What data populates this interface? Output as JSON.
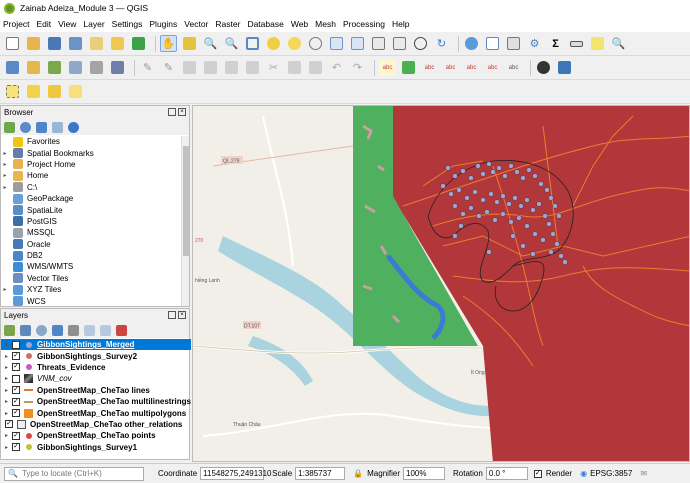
{
  "window": {
    "title": "Zainab Adeiza_Module 3 — QGIS"
  },
  "menu": [
    "Project",
    "Edit",
    "View",
    "Layer",
    "Settings",
    "Plugins",
    "Vector",
    "Raster",
    "Database",
    "Web",
    "Mesh",
    "Processing",
    "Help"
  ],
  "browser": {
    "title": "Browser",
    "items": [
      {
        "label": "Favorites",
        "icon": "star-icon",
        "color": "#f2c511",
        "expand": false
      },
      {
        "label": "Spatial Bookmarks",
        "icon": "bookmark-icon",
        "color": "#6a7ba8",
        "expand": true
      },
      {
        "label": "Project Home",
        "icon": "folder-icon",
        "color": "#e8b44f",
        "expand": true
      },
      {
        "label": "Home",
        "icon": "folder-icon",
        "color": "#e8b44f",
        "expand": true
      },
      {
        "label": "C:\\",
        "icon": "drive-icon",
        "color": "#9c9c9c",
        "expand": true
      },
      {
        "label": "GeoPackage",
        "icon": "geopackage-icon",
        "color": "#6a9fd6",
        "expand": false
      },
      {
        "label": "SpatiaLite",
        "icon": "spatialite-icon",
        "color": "#5a8fc5",
        "expand": false
      },
      {
        "label": "PostGIS",
        "icon": "postgis-icon",
        "color": "#3f6fa8",
        "expand": false
      },
      {
        "label": "MSSQL",
        "icon": "mssql-icon",
        "color": "#9aa4b0",
        "expand": false
      },
      {
        "label": "Oracle",
        "icon": "oracle-icon",
        "color": "#4779b6",
        "expand": false
      },
      {
        "label": "DB2",
        "icon": "db2-icon",
        "color": "#4c86c6",
        "expand": false
      },
      {
        "label": "WMS/WMTS",
        "icon": "globe-icon",
        "color": "#3d8fd4",
        "expand": false
      },
      {
        "label": "Vector Tiles",
        "icon": "vector-tiles-icon",
        "color": "#6b8fc2",
        "expand": false
      },
      {
        "label": "XYZ Tiles",
        "icon": "xyz-tiles-icon",
        "color": "#5b9ad8",
        "expand": true
      },
      {
        "label": "WCS",
        "icon": "wcs-icon",
        "color": "#5b9ad8",
        "expand": false
      }
    ]
  },
  "layers": {
    "title": "Layers",
    "items": [
      {
        "label": "GibbonSightings_Merged",
        "sym": "point",
        "color": "#9fa3d6",
        "checked": true,
        "selected": true,
        "italic": false,
        "group": false
      },
      {
        "label": "GibbonSightings_Survey2",
        "sym": "point",
        "color": "#d56f5f",
        "checked": true,
        "selected": false,
        "italic": false,
        "group": false
      },
      {
        "label": "Threats_Evidence",
        "sym": "point",
        "color": "#c45cc4",
        "checked": true,
        "selected": false,
        "italic": false,
        "group": false
      },
      {
        "label": "VNM_cov",
        "sym": "raster",
        "color": "#6a7ba8",
        "checked": false,
        "selected": false,
        "italic": true,
        "group": false
      },
      {
        "label": "OpenStreetMap_CheTao lines",
        "sym": "line",
        "color": "#e07b34",
        "checked": true,
        "selected": false,
        "italic": false,
        "group": false
      },
      {
        "label": "OpenStreetMap_CheTao multilinestrings",
        "sym": "line",
        "color": "#bf9a5a",
        "checked": true,
        "selected": false,
        "italic": false,
        "group": false
      },
      {
        "label": "OpenStreetMap_CheTao multipolygons",
        "sym": "poly",
        "color": "#ef8f1e",
        "checked": true,
        "selected": false,
        "italic": false,
        "group": false
      },
      {
        "label": "OpenStreetMap_CheTao other_relations",
        "sym": "table",
        "color": "#888888",
        "checked": true,
        "selected": false,
        "italic": false,
        "group": true
      },
      {
        "label": "OpenStreetMap_CheTao points",
        "sym": "point",
        "color": "#e0483e",
        "checked": true,
        "selected": false,
        "italic": false,
        "group": false
      },
      {
        "label": "GibbonSightings_Survey1",
        "sym": "point",
        "color": "#c4c03c",
        "checked": true,
        "selected": false,
        "italic": false,
        "group": false
      }
    ]
  },
  "map_labels": [
    "QL.279",
    "DT.107",
    "Ít Ong",
    "Thuận Châu",
    "hiềng Lanh",
    "270"
  ],
  "status": {
    "locator_placeholder": "Type to locate (Ctrl+K)",
    "coordinate_label": "Coordinate",
    "coordinate_value": "11548275,2491310",
    "scale_label": "Scale",
    "scale_value": "1:385737",
    "magnifier_label": "Magnifier",
    "magnifier_value": "100%",
    "rotation_label": "Rotation",
    "rotation_value": "0.0 °",
    "render_label": "Render",
    "crs_label": "EPSG:3857"
  },
  "colors": {
    "threat_zone": "#b2373a",
    "forest": "#4fb05f",
    "water": "#a9d3df",
    "gibbon_points": "#9fa3d6",
    "roads": "#f07a2e",
    "selection": "#0078d7"
  }
}
